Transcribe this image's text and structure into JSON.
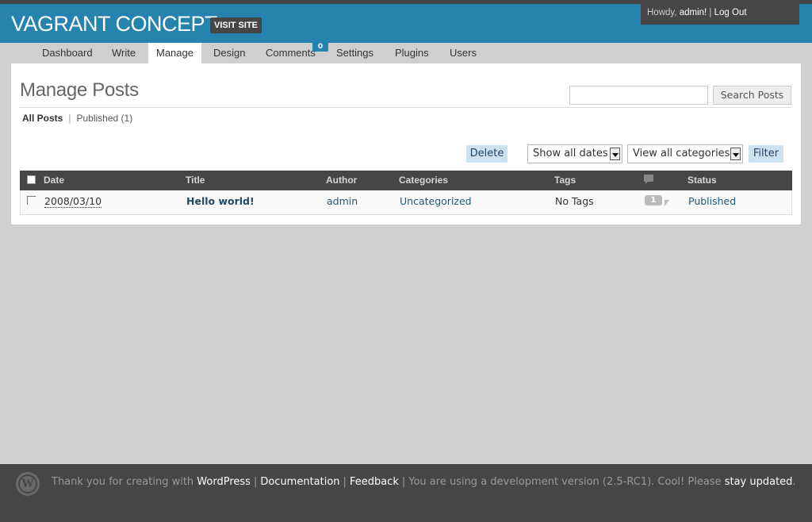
{
  "header": {
    "site_title": "VAGRANT CONCEPT",
    "visit_site": "VISIT SITE",
    "howdy": "Howdy, ",
    "user": "admin!",
    "separator": " | ",
    "logout": "Log Out"
  },
  "nav": {
    "items": [
      {
        "label": "Dashboard"
      },
      {
        "label": "Write"
      },
      {
        "label": "Manage",
        "active": true
      },
      {
        "label": "Design"
      },
      {
        "label": "Comments",
        "badge": "0"
      },
      {
        "label": "Settings"
      },
      {
        "label": "Plugins"
      },
      {
        "label": "Users"
      }
    ]
  },
  "page": {
    "title": "Manage Posts",
    "search_placeholder": "",
    "search_button": "Search Posts",
    "filter_all": "All Posts",
    "filter_sep": "|",
    "filter_published": "Published (1)"
  },
  "actions": {
    "delete": "Delete",
    "dates_select": "Show all dates",
    "categories_select": "View all categories",
    "filter": "Filter"
  },
  "table": {
    "columns": [
      "Date",
      "Title",
      "Author",
      "Categories",
      "Tags",
      "Status"
    ],
    "rows": [
      {
        "date": "2008/03/10",
        "title": "Hello world!",
        "author": "admin",
        "categories": "Uncategorized",
        "tags": "No Tags",
        "comments": "1",
        "status": "Published"
      }
    ]
  },
  "footer": {
    "prefix": "Thank you for creating with ",
    "wordpress": "WordPress",
    "sep": "|",
    "documentation": "Documentation",
    "feedback": "Feedback",
    "dev_text": "You are using a development version (2.5-RC1). Cool! Please ",
    "stay_updated": "stay updated",
    "suffix": "."
  },
  "colors": {
    "header_bg": "#2683ae",
    "dark_bar": "#464646",
    "button_bg": "#cee1ef",
    "page_bg": "#cfcfcf"
  }
}
